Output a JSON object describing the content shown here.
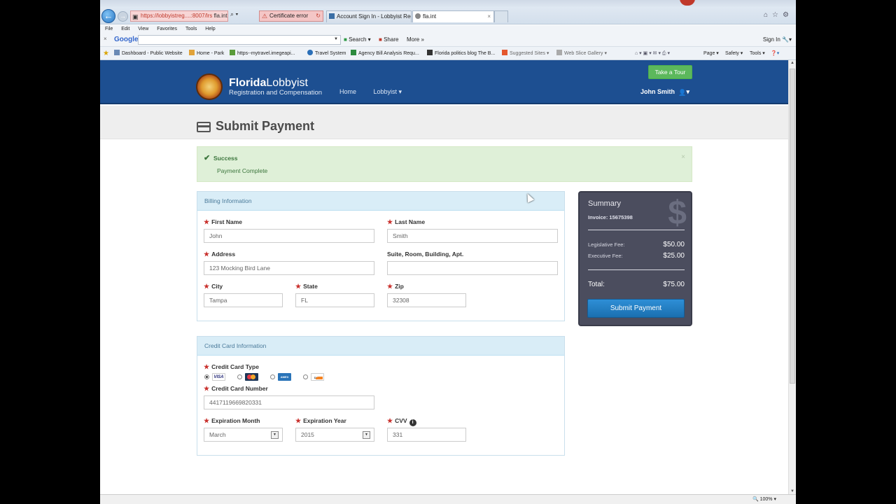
{
  "browser": {
    "address_text": "https://lobbyistreg....:8007/lrs",
    "address_host": "fla.int",
    "address_tools": "⌕ ▾",
    "cert_label": "Certificate error",
    "tabs": [
      {
        "label": "Account Sign In - Lobbyist Reg..."
      },
      {
        "label": "fla.int"
      }
    ],
    "menu": [
      "File",
      "Edit",
      "View",
      "Favorites",
      "Tools",
      "Help"
    ],
    "google": {
      "logo": "Google",
      "search_btn": "Search",
      "share_btn": "Share",
      "more_btn": "More »",
      "signin": "Sign In"
    },
    "favorites": [
      "Dashboard - Public Website",
      "Home - Park",
      "https--mytravel.imegeapi...",
      "Travel System",
      "Agency Bill Analysis Requ...",
      "Florida politics blog The B...",
      "Suggested Sites ▾",
      "Web Slice Gallery ▾"
    ],
    "commands": [
      "Page ▾",
      "Safety ▾",
      "Tools ▾"
    ],
    "zoom": "100%"
  },
  "site": {
    "brand_bold": "Florida",
    "brand_light": "Lobbyist",
    "brand_sub": "Registration and Compensation",
    "nav": [
      "Home",
      "Lobbyist ▾"
    ],
    "tour_btn": "Take a Tour",
    "user": "John Smith"
  },
  "page": {
    "title": "Submit Payment",
    "alert": {
      "title": "Success",
      "message": "Payment Complete",
      "close": "×"
    }
  },
  "billing": {
    "header": "Billing Information",
    "first_name_label": "First Name",
    "first_name": "John",
    "last_name_label": "Last Name",
    "last_name": "Smith",
    "address_label": "Address",
    "address": "123 Mocking Bird Lane",
    "suite_label": "Suite, Room, Building, Apt.",
    "suite": "",
    "city_label": "City",
    "city": "Tampa",
    "state_label": "State",
    "state": "FL",
    "zip_label": "Zip",
    "zip": "32308"
  },
  "credit": {
    "header": "Credit Card Information",
    "type_label": "Credit Card Type",
    "selected_type": "visa",
    "number_label": "Credit Card Number",
    "number": "4417119669820331",
    "month_label": "Expiration Month",
    "month": "March",
    "year_label": "Expiration Year",
    "year": "2015",
    "cvv_label": "CVV",
    "cvv": "331"
  },
  "summary": {
    "title": "Summary",
    "invoice": "Invoice: 15675398",
    "leg_fee_label": "Legislative Fee:",
    "leg_fee": "$50.00",
    "exec_fee_label": "Executive Fee:",
    "exec_fee": "$25.00",
    "total_label": "Total:",
    "total": "$75.00",
    "button": "Submit Payment"
  }
}
